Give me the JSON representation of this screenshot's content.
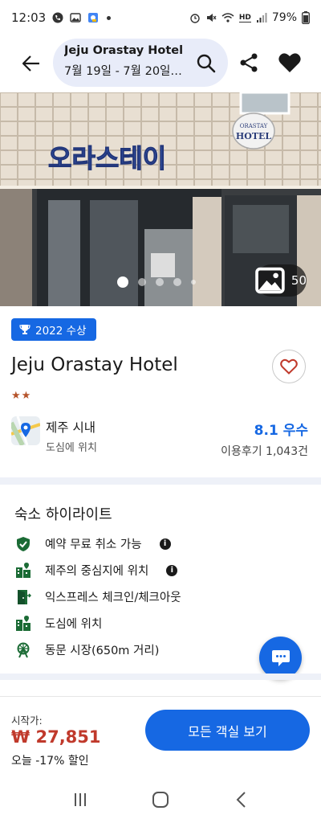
{
  "status_bar": {
    "time": "12:03",
    "battery": "79%",
    "signal_text": "HD"
  },
  "header": {
    "title": "Jeju Orastay Hotel",
    "dates": "7월 19일 - 7월 20일, ...",
    "icons": [
      "back-arrow-icon",
      "search-icon",
      "share-icon",
      "heart-filled-icon"
    ]
  },
  "gallery": {
    "sign_korean": "오라스테이",
    "sign_english": "ORASTAY HOTEL",
    "photo_count": "50",
    "dots": 5,
    "active_dot": 0
  },
  "hotel": {
    "award_label": "2022 수상",
    "name": "Jeju Orastay Hotel",
    "star_rating": 2,
    "location_name": "제주 시내",
    "location_sub": "도심에 위치",
    "rating": "8.1 우수",
    "reviews": "이용후기 1,043건"
  },
  "highlights": {
    "title": "숙소 하이라이트",
    "items": [
      {
        "label": "예약 무료 취소 가능",
        "icon": "shield-check-icon",
        "info": true
      },
      {
        "label": "제주의 중심지에 위치",
        "icon": "city-pin-icon",
        "info": true
      },
      {
        "label": "익스프레스 체크인/체크아웃",
        "icon": "door-icon",
        "info": false
      },
      {
        "label": "도심에 위치",
        "icon": "city-icon",
        "info": false
      },
      {
        "label": "동문 시장(650m 거리)",
        "icon": "ferris-wheel-icon",
        "info": false
      }
    ]
  },
  "booking": {
    "price_from_label": "시작가:",
    "price": "₩ 27,851",
    "discount": "오늘 -17% 할인",
    "cta": "모든 객실 보기"
  },
  "colors": {
    "accent": "#1668e3",
    "price": "#c0392b",
    "star": "#b5532a",
    "pill": "#e8ecf9"
  }
}
